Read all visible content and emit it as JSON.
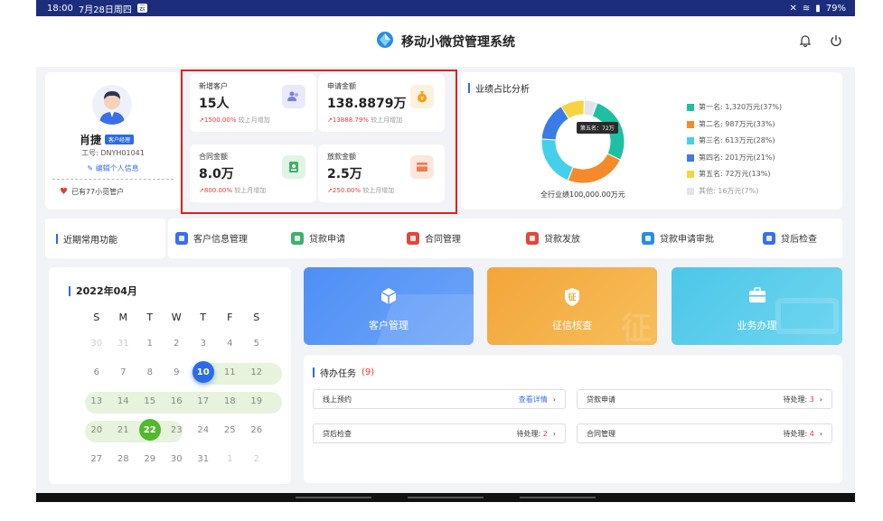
{
  "status": {
    "time": "18:00",
    "date": "7月28日周四",
    "app_badge": "云",
    "battery": "79%"
  },
  "header": {
    "title": "移动小微贷管理系统"
  },
  "profile": {
    "name": "肖捷",
    "role_badge": "客户经理",
    "staff_id": "工号: DNYH01041",
    "edit_label": "编辑个人信息",
    "managed": "已有77小觅管户"
  },
  "stats": [
    {
      "label": "新增客户",
      "value": "15人",
      "change": "1500.00%",
      "suffix": "较上月增加",
      "icon": "users-icon",
      "color": "#7a7de8",
      "bg": "#e8e9fb"
    },
    {
      "label": "申请金额",
      "value": "138.8879万",
      "change": "13888.79%",
      "suffix": "较上月增加",
      "icon": "money-bag-icon",
      "color": "#f0a020",
      "bg": "#fdf1dc"
    },
    {
      "label": "合同金额",
      "value": "8.0万",
      "change": "800.00%",
      "suffix": "较上月增加",
      "icon": "contract-user-icon",
      "color": "#3fb06a",
      "bg": "#e0f4e6"
    },
    {
      "label": "放款金额",
      "value": "2.5万",
      "change": "250.00%",
      "suffix": "较上月增加",
      "icon": "card-icon",
      "color": "#f07a50",
      "bg": "#fde6dc"
    }
  ],
  "performance": {
    "title": "业绩占比分析",
    "total": "全行业绩100,000.00万元",
    "tooltip": "第五名：72万"
  },
  "chart_data": {
    "type": "pie",
    "title": "业绩占比分析",
    "categories": [
      "第一名",
      "第二名",
      "第三名",
      "第四名",
      "第五名",
      "其他"
    ],
    "values": [
      1320,
      987,
      613,
      201,
      72,
      16
    ],
    "percents": [
      37,
      33,
      28,
      21,
      13,
      7
    ],
    "legend_labels": [
      "第一名: 1,320万元(37%)",
      "第二名: 987万元(33%)",
      "第三名: 613万元(28%)",
      "第四名: 201万元(21%)",
      "第五名: 72万元(13%)",
      "其他: 16万元(7%)"
    ],
    "colors": [
      "#1fbfa3",
      "#f58a2a",
      "#45d0ea",
      "#3a7be6",
      "#f5d440",
      "#e3e3e8"
    ],
    "legend_position": "right"
  },
  "quick": {
    "title": "近期常用功能",
    "items": [
      {
        "label": "客户信息管理",
        "icon": "user-manage-icon",
        "color": "#3a6fe8"
      },
      {
        "label": "贷款申请",
        "icon": "apply-doc-icon",
        "color": "#3fb06a"
      },
      {
        "label": "合同管理",
        "icon": "contract-doc-icon",
        "color": "#e2473b"
      },
      {
        "label": "贷款发放",
        "icon": "wallet-icon",
        "color": "#e2473b"
      },
      {
        "label": "贷款申请审批",
        "icon": "approval-icon",
        "color": "#2a8de0"
      },
      {
        "label": "贷后检查",
        "icon": "check-doc-icon",
        "color": "#3a6fe8"
      }
    ]
  },
  "calendar": {
    "month": "2022年04月",
    "weekdays": [
      "S",
      "M",
      "T",
      "W",
      "T",
      "F",
      "S"
    ],
    "weeks": [
      [
        "30",
        "31",
        "1",
        "2",
        "3",
        "4",
        "5"
      ],
      [
        "6",
        "7",
        "8",
        "9",
        "10",
        "11",
        "12"
      ],
      [
        "13",
        "14",
        "15",
        "16",
        "17",
        "18",
        "19"
      ],
      [
        "20",
        "21",
        "22",
        "23",
        "24",
        "25",
        "26"
      ],
      [
        "27",
        "28",
        "29",
        "30",
        "31",
        "1",
        "2"
      ]
    ],
    "today": "10",
    "selected": "22"
  },
  "tiles": [
    {
      "label": "客户管理",
      "icon": "cube-icon"
    },
    {
      "label": "征信核查",
      "icon": "credit-shield-icon",
      "glyph": "征"
    },
    {
      "label": "业务办理",
      "icon": "briefcase-icon"
    }
  ],
  "todo": {
    "title": "待办任务",
    "count": "(9)",
    "items": [
      {
        "name": "线上预约",
        "action": "查看详情",
        "value": ""
      },
      {
        "name": "贷款申请",
        "action": "待处理: ",
        "value": "3"
      },
      {
        "name": "贷后检查",
        "action": "待处理: ",
        "value": "2"
      },
      {
        "name": "合同管理",
        "action": "待处理: ",
        "value": "4"
      }
    ]
  }
}
